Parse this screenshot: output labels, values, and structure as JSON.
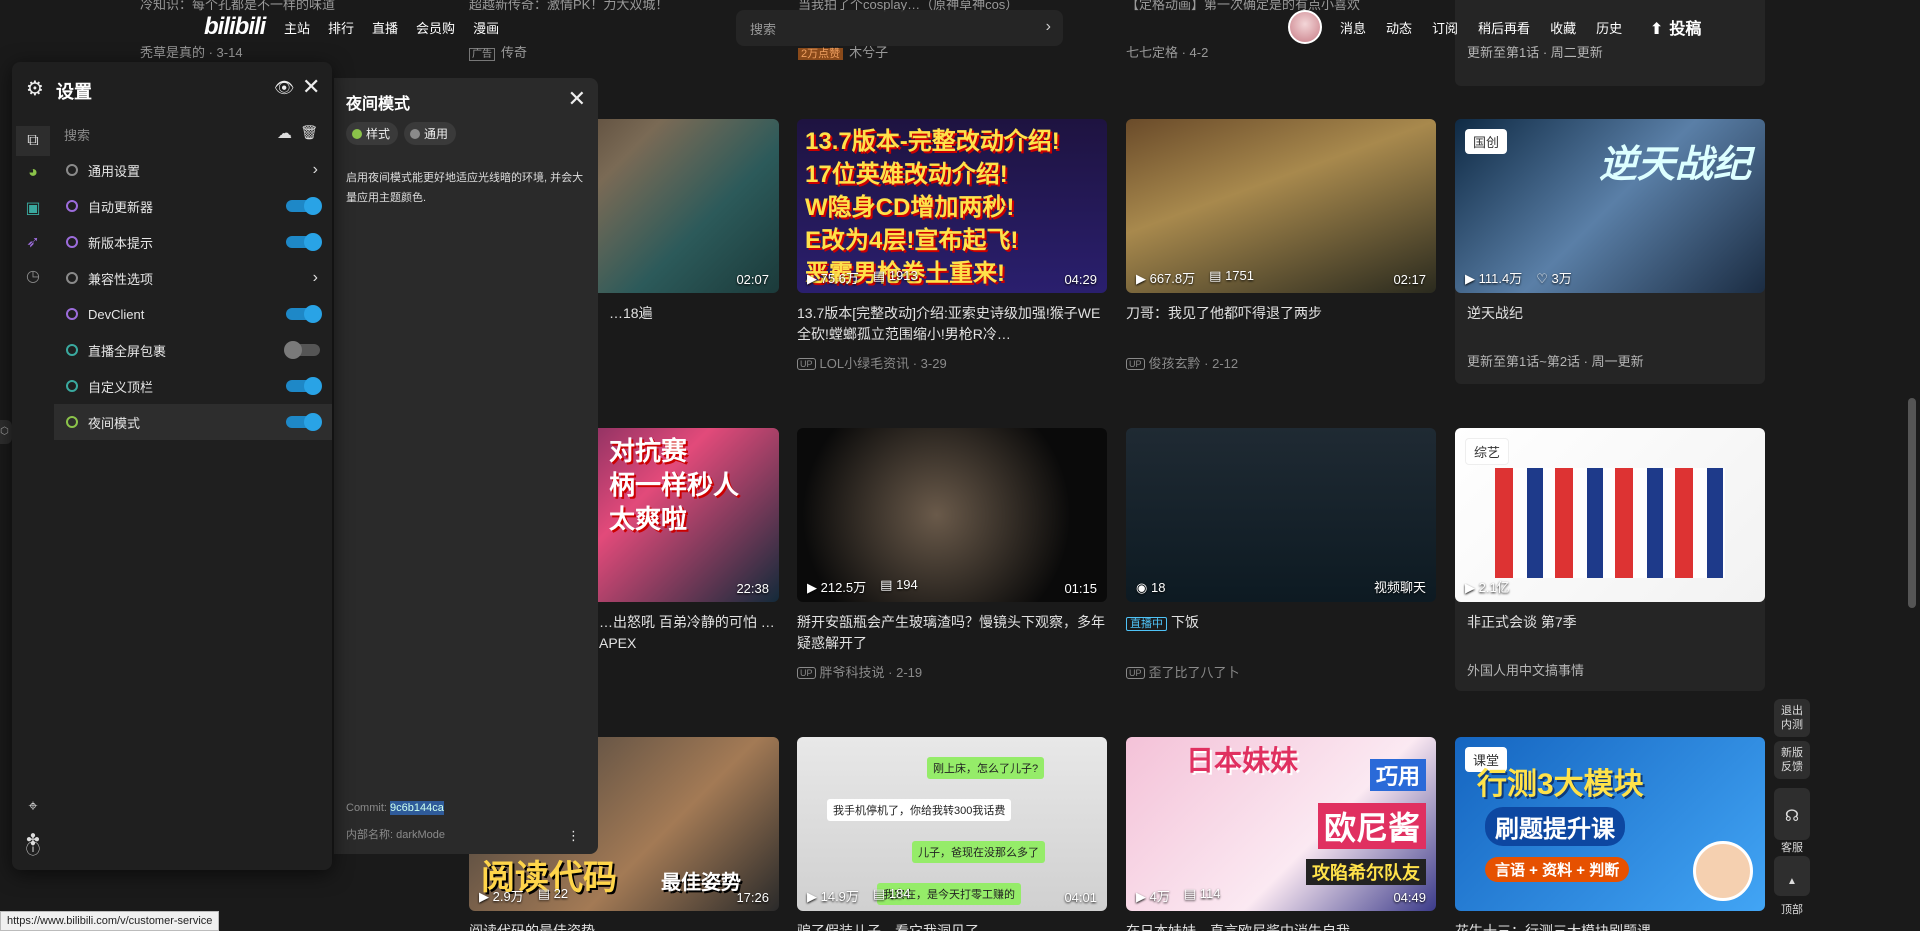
{
  "topbar": {
    "logo": "bilibili",
    "nav_left": [
      "主站",
      "排行",
      "直播",
      "会员购",
      "漫画"
    ],
    "search_placeholder": "搜索",
    "nav_right": [
      "消息",
      "动态",
      "订阅",
      "稍后再看",
      "收藏",
      "历史"
    ],
    "upload": "投稿"
  },
  "old_row": [
    {
      "title": "冷知识：每个孔都是不一样的味道",
      "meta": "秃草是真的 · 3-14"
    },
    {
      "title": "超越新传奇：激情PK！力大双城！",
      "meta": "传奇",
      "badge": "广告"
    },
    {
      "title": "当我拍了个cosplay…（原神草神cos）",
      "meta": "木兮子",
      "badge": "2万点赞"
    },
    {
      "title": "【定格动画】第一次确定是的有点小喜欢",
      "meta": "七七定格 · 4-2"
    },
    {
      "title": "更新至第1话 · 周二更新",
      "meta": ""
    }
  ],
  "cards": [
    {
      "title": "…18遍",
      "meta": "",
      "stats": [],
      "duration": "02:07"
    },
    {
      "title": "13.7版本[完整改动]介绍:亚索史诗级加强!猴子WE全砍!螳螂孤立范围缩小!男枪R冷…",
      "up": "LOL小绿毛资讯",
      "date": "3-29",
      "stats": [
        "75.6万",
        "1913"
      ],
      "duration": "04:29",
      "overlay": [
        "13.7版本-完整改动介绍!",
        "17位英雄改动介绍!",
        "W隐身CD增加两秒!",
        "E改为4层!宣布起飞!",
        "恶霸男枪卷土重来!"
      ]
    },
    {
      "title": "刀哥：我见了他都吓得退了两步",
      "up": "俊孩玄黔",
      "date": "2-12",
      "stats": [
        "667.8万",
        "1751"
      ],
      "duration": "02:17"
    },
    {
      "title": "逆天战纪",
      "tag": "国创",
      "stats": [
        "111.4万",
        "3万"
      ],
      "update": "更新至第1话~第2话 · 周一更新",
      "overlay_title": "逆天战纪"
    },
    {
      "title": "…出怒吼 百弟冷静的可怕 …APEX",
      "stats": [],
      "duration": "22:38",
      "overlay": [
        "对抗赛",
        "柄一样秒人",
        "太爽啦"
      ]
    },
    {
      "title": "掰开安瓿瓶会产生玻璃渣吗？慢镜头下观察，多年疑惑解开了",
      "up": "胖爷科技说",
      "date": "2-19",
      "stats": [
        "212.5万",
        "194"
      ],
      "duration": "01:15"
    },
    {
      "title": "下饭",
      "live": "直播中",
      "up": "歪了比了八了卜",
      "stats": [
        "18"
      ],
      "duration": "视频聊天"
    },
    {
      "title": "非正式会谈 第7季",
      "tag": "综艺",
      "stats": [
        "2.1亿"
      ],
      "update": "外国人用中文搞事情"
    },
    {
      "title": "阅读代码的最佳姿势",
      "stats": [
        "2.9万",
        "22"
      ],
      "duration": "17:26",
      "overlay": [
        "阅读代码",
        "最佳姿势"
      ]
    },
    {
      "title": "骗了假装儿子，看它我洞见了",
      "stats": [
        "14.9万",
        "184"
      ],
      "duration": "04:01",
      "chat": [
        "刚上床，怎么了儿子?",
        "我手机停机了，你给我转300我话费",
        "儿子，爸现在没那么多了",
        "我实在，是今天打零工赚的"
      ]
    },
    {
      "title": "在日本妹妹，直言欧尼酱中消失自我",
      "stats": [
        "4万",
        "114"
      ],
      "duration": "04:49",
      "overlay": [
        "日本妹妹",
        "巧用",
        "欧尼酱",
        "攻陷希尔队友"
      ]
    },
    {
      "title": "花生十三：行测三大模块刷题课",
      "tag": "课堂",
      "overlay": [
        "行测3大模块",
        "刷题提升课",
        "言语 + 资料 + 判断"
      ],
      "badge": "花生十三"
    }
  ],
  "settings": {
    "title": "设置",
    "search_placeholder": "搜索",
    "items": [
      {
        "label": "通用设置",
        "type": "arrow",
        "dot": "#8a8a8a"
      },
      {
        "label": "自动更新器",
        "type": "toggle",
        "on": true,
        "dot": "#9c6cdb"
      },
      {
        "label": "新版本提示",
        "type": "toggle",
        "on": true,
        "dot": "#9c6cdb"
      },
      {
        "label": "兼容性选项",
        "type": "arrow",
        "dot": "#8a8a8a"
      },
      {
        "label": "DevClient",
        "type": "toggle",
        "on": true,
        "dot": "#9c6cdb"
      },
      {
        "label": "直播全屏包裹",
        "type": "toggle",
        "on": false,
        "dot": "#3aa99f"
      },
      {
        "label": "自定义顶栏",
        "type": "toggle",
        "on": true,
        "dot": "#3aa99f"
      },
      {
        "label": "夜间模式",
        "type": "toggle",
        "on": true,
        "dot": "#8bc34a",
        "active": true
      }
    ]
  },
  "detail": {
    "title": "夜间模式",
    "chips": [
      {
        "label": "样式",
        "color": "#8bc34a"
      },
      {
        "label": "通用",
        "color": "#8a8a8a"
      }
    ],
    "description": "启用夜间模式能更好地适应光线暗的环境, 并会大量应用主题颜色.",
    "commit_label": "Commit:",
    "commit_hash": "9c6b144ca",
    "internal_label": "内部名称: darkMode",
    "more": "⋮"
  },
  "fabs": [
    "退出\n内测",
    "新版\n反馈",
    "客服",
    "顶部"
  ],
  "status_url": "https://www.bilibili.com/v/customer-service"
}
